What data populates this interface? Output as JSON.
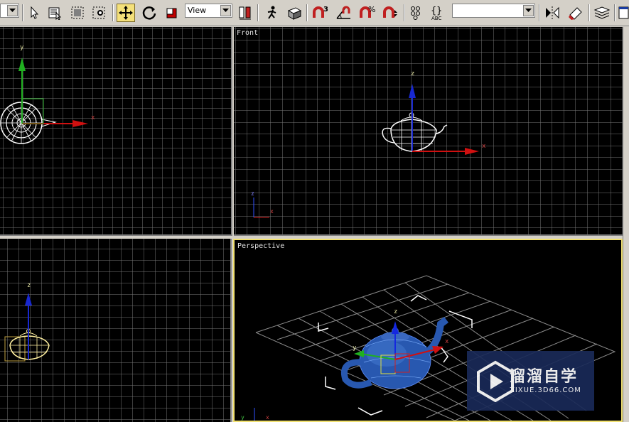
{
  "toolbar": {
    "view_combo": "View",
    "selection_set_combo": "",
    "snap_percent_label": "%",
    "angle_snap_label": "3"
  },
  "viewports": {
    "top": {
      "label": ""
    },
    "front": {
      "label": "Front"
    },
    "left": {
      "label": ""
    },
    "perspective": {
      "label": "Perspective"
    }
  },
  "axes": {
    "x": "x",
    "y": "y",
    "z": "z"
  },
  "watermark": {
    "title": "溜溜自学",
    "url": "ZIXUE.3D66.COM"
  },
  "colors": {
    "active_border": "#f0e070",
    "grid": "#7a7a7a",
    "x_axis": "#cc1010",
    "y_axis": "#10a010",
    "z_axis": "#1010cc",
    "teapot_blue": "#2050a0"
  }
}
